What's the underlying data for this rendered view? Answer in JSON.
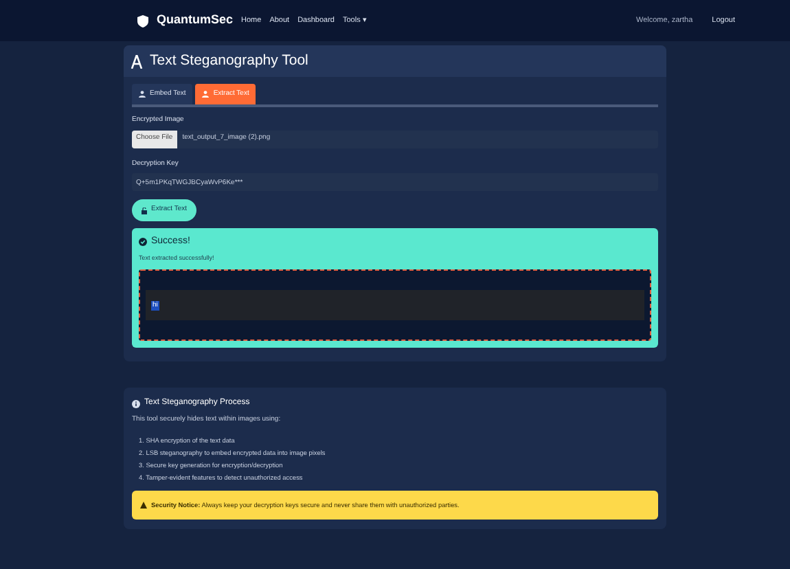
{
  "navbar": {
    "brand": "QuantumSec",
    "links": [
      "Home",
      "About",
      "Dashboard",
      "Tools ▾"
    ],
    "welcome": "Welcome, zartha",
    "logout": "Logout"
  },
  "tool": {
    "title": "Text Steganography Tool",
    "tabs": [
      {
        "label": "Embed Text",
        "selected": false
      },
      {
        "label": "Extract Text",
        "selected": true
      }
    ],
    "image_label": "Encrypted Image",
    "file_button": "Choose File",
    "file_name": "text_output_7_image (2).png",
    "key_label": "Decryption Key",
    "key_value": "Q+5m1PKqTWGJBCyaWvP6Ke***",
    "extract_button": "Extract Text",
    "result": {
      "title": "Success!",
      "message": "Text extracted successfully!",
      "output": "hi"
    }
  },
  "process": {
    "title": "Text Steganography Process",
    "intro": "This tool securely hides text within images using:",
    "steps": [
      "1. SHA encryption of the text data",
      "2. LSB steganography to embed encrypted data into image pixels",
      "3. Secure key generation for encryption/decryption",
      "4. Tamper-evident features to detect unauthorized access"
    ],
    "notice": "**Security Notice:** Always keep your decryption keys secure and never share them with unauthorized parties."
  }
}
